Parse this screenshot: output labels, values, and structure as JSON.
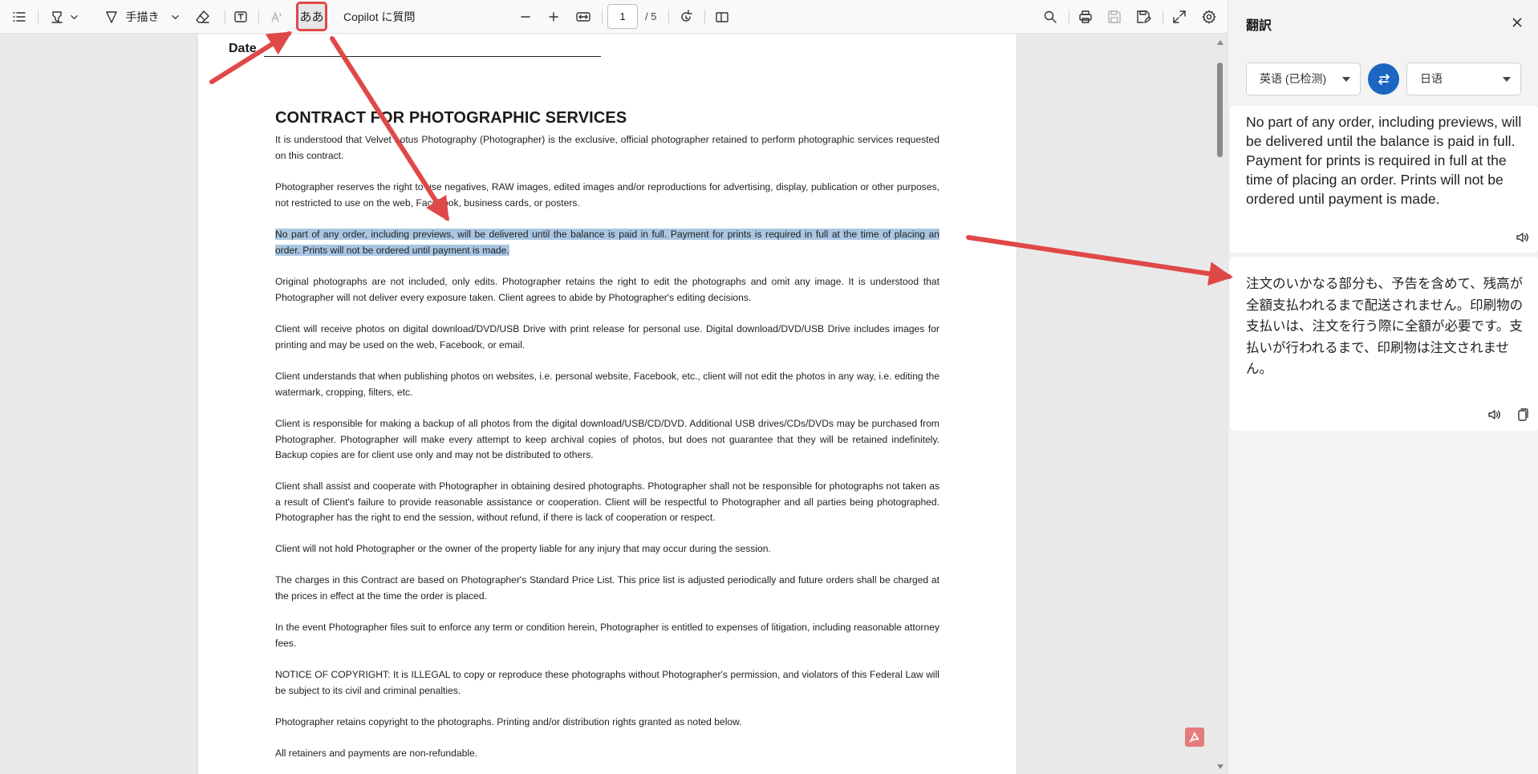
{
  "toolbar": {
    "draw_label": "手描き",
    "copilot_label": "Copilot に質問",
    "translate_glyph": "ああ",
    "page_current": "1",
    "page_total": "/ 5"
  },
  "document": {
    "date_label": "Date",
    "title": "CONTRACT FOR PHOTOGRAPHIC SERVICES",
    "paragraphs": [
      "It is understood that Velvet Lotus Photography (Photographer) is the exclusive, official photographer retained to perform photographic services requested on this contract.",
      "Photographer reserves the right to use negatives, RAW images, edited images and/or reproductions for advertising, display, publication or other purposes, not restricted to use on the web, Facebook, business cards, or posters.",
      "No part of any order, including previews, will be delivered until the balance is paid in full. Payment for prints is required in full at the time of placing an order. Prints will not be ordered until payment is made.",
      "Original photographs are not included, only edits. Photographer retains the right to edit the photographs and omit any image. It is understood that Photographer will not deliver every exposure taken. Client agrees to abide by Photographer's editing decisions.",
      "Client will receive photos on digital download/DVD/USB Drive with print release for personal use. Digital download/DVD/USB Drive includes images for printing and may be used on the web, Facebook, or email.",
      "Client understands that when publishing photos on websites, i.e. personal website, Facebook, etc., client will not edit the photos in any way, i.e. editing the watermark, cropping, filters, etc.",
      "Client is responsible for making a backup of all photos from the digital download/USB/CD/DVD. Additional USB drives/CDs/DVDs may be purchased from Photographer. Photographer will make every attempt to keep archival copies of photos, but does not guarantee that they will be retained indefinitely. Backup copies are for client use only and may not be distributed to others.",
      "Client shall assist and cooperate with Photographer in obtaining desired photographs. Photographer shall not be responsible for photographs not taken as a result of Client's failure to provide reasonable assistance or cooperation. Client will be respectful to Photographer and all parties being photographed. Photographer has the right to end the session, without refund, if there is lack of cooperation or respect.",
      "Client will not hold Photographer or the owner of the property liable for any injury that may occur during the session.",
      "The charges in this Contract are based on Photographer's Standard Price List. This price list is adjusted periodically and future orders shall be charged at the prices in effect at the time the order is placed.",
      "In the event Photographer files suit to enforce any term or condition herein, Photographer is entitled to expenses of litigation, including reasonable attorney fees.",
      "NOTICE OF COPYRIGHT: It is ILLEGAL to copy or reproduce these photographs without Photographer's permission, and violators of this Federal Law will be subject to its civil and criminal penalties.",
      "Photographer retains copyright to the photographs. Printing and/or distribution rights granted as noted below.",
      "All retainers and payments are non-refundable."
    ]
  },
  "panel": {
    "title": "翻訳",
    "source_lang": "英语 (已检测)",
    "target_lang": "日语",
    "source_text": "No part of any order, including previews, will be delivered until the balance is paid in full. Payment for prints is required in full at the time of placing an order. Prints will not be ordered until payment is made.",
    "translated_text": "注文のいかなる部分も、予告を含めて、残高が全額支払われるまで配送されません。印刷物の支払いは、注文を行う際に全額が必要です。支払いが行われるまで、印刷物は注文されません。"
  },
  "colors": {
    "highlight": "#a9c6e2",
    "accent": "#1a66c2",
    "annotation": "#e04848"
  }
}
